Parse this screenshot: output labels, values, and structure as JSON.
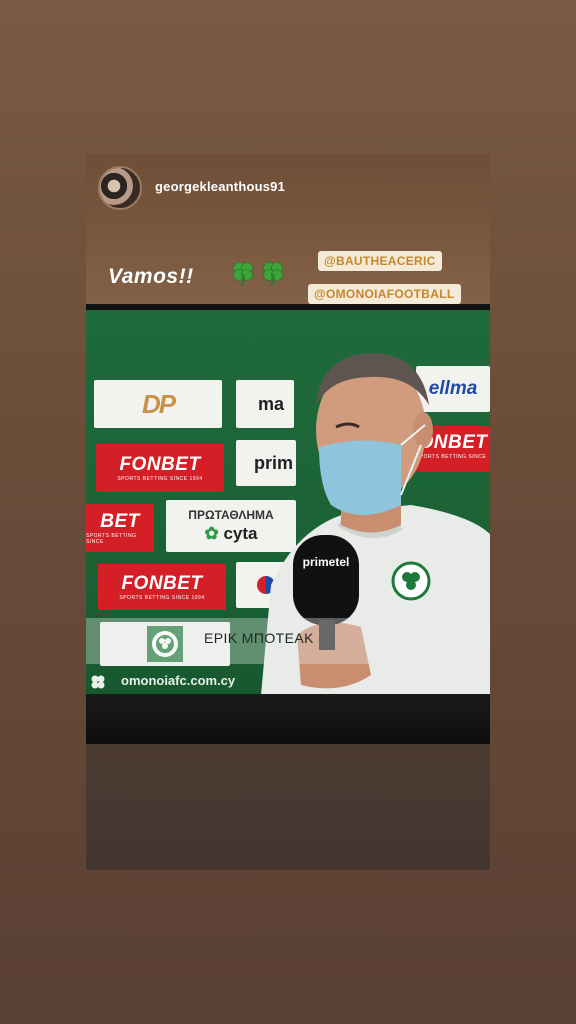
{
  "story": {
    "username": "georgekleanthous91",
    "caption": "Vamos!!",
    "stickers": [
      "clover-icon",
      "clover-icon"
    ],
    "mentions": [
      "@BAUTHEACERIC",
      "@OMONOIAFOOTBALL"
    ]
  },
  "broadcast": {
    "boards": {
      "sponsor_1": "FONBET",
      "sponsor_1_tagline": "SPORTS BETTING SINCE 1994",
      "sponsor_2": "FONBET",
      "sponsor_2_tagline": "SPORTS BETTING SINCE 1994",
      "sponsor_3": "BET",
      "sponsor_3_tagline": "SPORTS BETTING SINCE",
      "sponsor_4": "ONBET",
      "sponsor_4_tagline": "SPORTS BETTING SINCE 1",
      "league": "ΠΡΩΤΑΘΛΗΜΑ",
      "league_sponsor": "cyta",
      "prim": "prim",
      "ma": "ma",
      "ellma": "ellma",
      "dp_logo": "DP"
    },
    "mic_label": "primetel",
    "lower_third_name": "ΕΡΙΚ ΜΠΟΤΕΑΚ",
    "website": "omonoiafc.com.cy"
  },
  "colors": {
    "mention_text": "#c7862a",
    "board_red": "#d41f26",
    "pitch_green": "#1f6a3b"
  }
}
